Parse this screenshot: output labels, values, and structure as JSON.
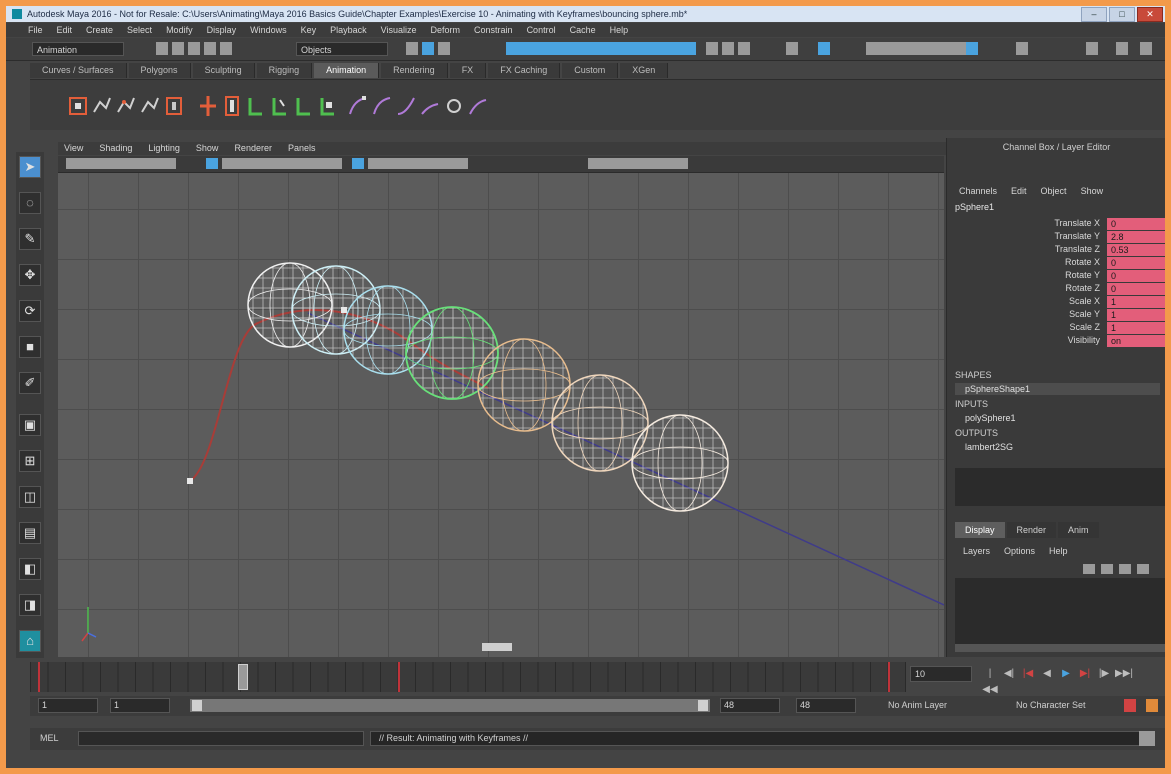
{
  "window": {
    "title": "Autodesk Maya 2016 - Not for Resale: C:\\Users\\Animating\\Maya 2016 Basics Guide\\Chapter Examples\\Exercise 10 - Animating with Keyframes\\bouncing sphere.mb*",
    "minimize": "–",
    "maximize": "□",
    "close": "✕"
  },
  "menubar": [
    "File",
    "Edit",
    "Create",
    "Select",
    "Modify",
    "Display",
    "Windows",
    "Key",
    "Playback",
    "Visualize",
    "Deform",
    "Constrain",
    "Control",
    "Cache",
    "Help"
  ],
  "statusline": {
    "mode": "Animation",
    "object_select": "Objects"
  },
  "shelf": {
    "tabs": [
      "Curves / Surfaces",
      "Polygons",
      "Sculpting",
      "Rigging",
      "Animation",
      "Rendering",
      "FX",
      "FX Caching",
      "Custom",
      "XGen"
    ],
    "active_tab": "Animation"
  },
  "panel_menu": [
    "View",
    "Shading",
    "Lighting",
    "Show",
    "Renderer",
    "Panels"
  ],
  "channel_box": {
    "title": "Channel Box / Layer Editor",
    "menu": [
      "Channels",
      "Edit",
      "Object",
      "Show"
    ],
    "object_name": "pSphere1",
    "attributes": [
      {
        "name": "Translate X",
        "value": "0"
      },
      {
        "name": "Translate Y",
        "value": "2.8"
      },
      {
        "name": "Translate Z",
        "value": "0.53"
      },
      {
        "name": "Rotate X",
        "value": "0"
      },
      {
        "name": "Rotate Y",
        "value": "0"
      },
      {
        "name": "Rotate Z",
        "value": "0"
      },
      {
        "name": "Scale X",
        "value": "1"
      },
      {
        "name": "Scale Y",
        "value": "1"
      },
      {
        "name": "Scale Z",
        "value": "1"
      },
      {
        "name": "Visibility",
        "value": "on"
      }
    ],
    "sections": [
      {
        "header": "SHAPES",
        "items": [
          "pSphereShape1"
        ]
      },
      {
        "header": "INPUTS",
        "items": [
          "polySphere1"
        ]
      },
      {
        "header": "OUTPUTS",
        "items": [
          "lambert2SG"
        ]
      }
    ]
  },
  "layer_editor": {
    "tabs": [
      "Display",
      "Render",
      "Anim"
    ],
    "active_tab": "Display",
    "menu": [
      "Layers",
      "Options",
      "Help"
    ]
  },
  "timeline": {
    "current_frame": "10",
    "playback_buttons": [
      "|◀◀",
      "◀|",
      "|◀",
      "◀",
      "▶",
      "▶|",
      "|▶",
      "▶▶|"
    ]
  },
  "range": {
    "start": "1",
    "start_inner": "1",
    "end_inner": "48",
    "end": "48",
    "anim_layer": "No Anim Layer",
    "character_set": "No Character Set"
  },
  "command_line": {
    "label": "MEL",
    "result": "// Result: Animating with Keyframes //"
  },
  "colors": {
    "accent": "#4aa3df",
    "keyed_field": "#e35e7a",
    "viewport_bg": "#5c5c5c",
    "motion_trail": "#a83d38",
    "path_line": "#3f3b8a"
  },
  "icons": {
    "select_tool": "arrow-icon",
    "lasso_tool": "lasso-icon",
    "paint_tool": "brush-icon",
    "move_tool": "move-icon",
    "rotate_tool": "rotate-icon",
    "scale_tool": "scale-icon"
  }
}
